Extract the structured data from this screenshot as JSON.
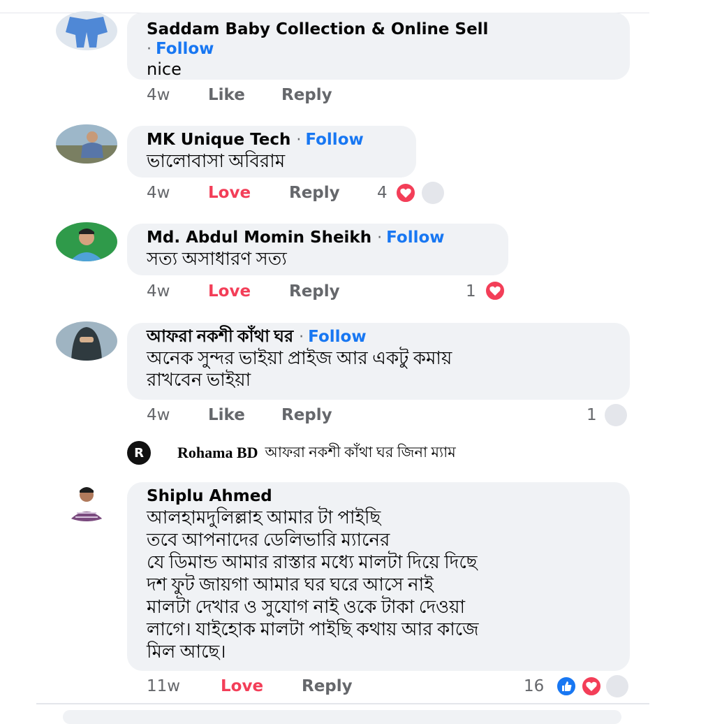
{
  "comments": [
    {
      "author": "Saddam Baby Collection & Online Sell",
      "separator": "·",
      "follow": "Follow",
      "text": "nice",
      "time": "4w",
      "like": "Like",
      "reply": "Reply"
    },
    {
      "author": "MK Unique Tech",
      "separator": "·",
      "follow": "Follow",
      "text": "ভালোবাসা অবিরাম",
      "time": "4w",
      "like": "Love",
      "reply": "Reply",
      "reactions": "4"
    },
    {
      "author": "Md. Abdul Momin Sheikh",
      "separator": "·",
      "follow": "Follow",
      "text": "সত্য অসাধারণ সত্য",
      "time": "4w",
      "like": "Love",
      "reply": "Reply",
      "reactions": "1"
    },
    {
      "author": "আফরা নকশী কাঁথা ঘর",
      "separator": "·",
      "follow": "Follow",
      "text_lines": [
        "অনেক সুন্দর ভাইয়া প্রাইজ আর একটু কমায়",
        "রাখবেন  ভাইয়া"
      ],
      "time": "4w",
      "like": "Like",
      "reply": "Reply",
      "reactions": "1"
    },
    {
      "author": "Shiplu Ahmed",
      "text_lines": [
        "আলহামদুলিল্লাহ আমার টা পাইছি",
        "তবে আপনাদের ডেলিভারি ম্যানের",
        "যে ডিমান্ড আমার রাস্তার মধ্যে মালটা দিয়ে দিছে",
        "দশ ফুট জায়গা আমার ঘর ঘরে আসে নাই",
        "মালটা দেখার ও সুযোগ নাই ওকে টাকা দেওয়া",
        "লাগে। যাইহোক মালটা পাইছি কথায় আর কাজে",
        "মিল আছে।"
      ],
      "time": "11w",
      "like": "Love",
      "reply": "Reply",
      "reactions": "16"
    }
  ],
  "reply_preview": {
    "logo": "R",
    "author": "Rohama BD",
    "text": "আফরা নকশী কাঁথা ঘর জিনা ম্যাম"
  },
  "colors": {
    "follow": "#1877f2",
    "love": "#f33e58",
    "muted": "#65676b",
    "bubble": "#f0f2f5"
  },
  "icons": [
    "love-reaction-icon",
    "like-reaction-icon"
  ]
}
